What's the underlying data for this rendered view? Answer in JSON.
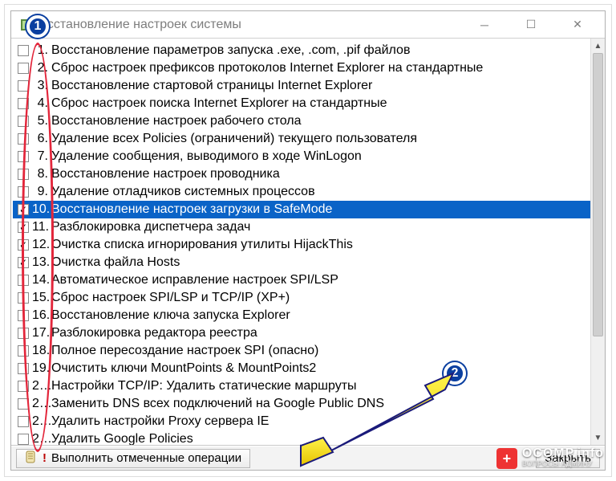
{
  "window": {
    "title": "осстановление настроек системы"
  },
  "items": [
    {
      "n": "1.",
      "checked": false,
      "selected": false,
      "label": "Восстановление параметров запуска .exe, .com, .pif файлов"
    },
    {
      "n": "2.",
      "checked": false,
      "selected": false,
      "label": "Сброс настроек префиксов протоколов Internet Explorer на стандартные"
    },
    {
      "n": "3.",
      "checked": false,
      "selected": false,
      "label": "Восстановление стартовой страницы Internet Explorer"
    },
    {
      "n": "4.",
      "checked": false,
      "selected": false,
      "label": "Сброс настроек поиска Internet Explorer на стандартные"
    },
    {
      "n": "5.",
      "checked": false,
      "selected": false,
      "label": "Восстановление настроек рабочего стола"
    },
    {
      "n": "6.",
      "checked": false,
      "selected": false,
      "label": "Удаление всех Policies (ограничений) текущего пользователя"
    },
    {
      "n": "7.",
      "checked": false,
      "selected": false,
      "label": "Удаление сообщения, выводимого в ходе WinLogon"
    },
    {
      "n": "8.",
      "checked": false,
      "selected": false,
      "label": "Восстановление настроек проводника"
    },
    {
      "n": "9.",
      "checked": false,
      "selected": false,
      "label": "Удаление отладчиков системных процессов"
    },
    {
      "n": "10.",
      "checked": true,
      "selected": true,
      "label": "Восстановление настроек загрузки в SafeMode"
    },
    {
      "n": "11.",
      "checked": true,
      "selected": false,
      "label": "Разблокировка диспетчера задач"
    },
    {
      "n": "12.",
      "checked": true,
      "selected": false,
      "label": "Очистка списка игнорирования утилиты HijackThis"
    },
    {
      "n": "13.",
      "checked": true,
      "selected": false,
      "label": "Очистка файла Hosts"
    },
    {
      "n": "14.",
      "checked": false,
      "selected": false,
      "label": "Автоматическое исправление настроек SPI/LSP"
    },
    {
      "n": "15.",
      "checked": false,
      "selected": false,
      "label": "Сброс настроек SPI/LSP и TCP/IP (XP+)"
    },
    {
      "n": "16.",
      "checked": false,
      "selected": false,
      "label": "Восстановление ключа запуска Explorer"
    },
    {
      "n": "17.",
      "checked": false,
      "selected": false,
      "label": "Разблокировка редактора реестра"
    },
    {
      "n": "18.",
      "checked": false,
      "selected": false,
      "label": "Полное пересоздание настроек SPI (опасно)"
    },
    {
      "n": "19.",
      "checked": false,
      "selected": false,
      "label": "Очистить ключи MountPoints & MountPoints2"
    },
    {
      "n": "2…",
      "checked": false,
      "selected": false,
      "label": "Настройки TCP/IP: Удалить статические маршруты"
    },
    {
      "n": "2…",
      "checked": false,
      "selected": false,
      "label": "Заменить DNS всех подключений на Google Public DNS"
    },
    {
      "n": "2…",
      "checked": false,
      "selected": false,
      "label": "Удалить настройки Proxy сервера IE"
    },
    {
      "n": "2…",
      "checked": false,
      "selected": false,
      "label": "Удалить Google Policies"
    }
  ],
  "buttons": {
    "execute": "Выполнить отмеченные операции",
    "close": "Закрыть"
  },
  "annotations": {
    "badge1": "1",
    "badge2": "2"
  },
  "watermark": {
    "line1": "OCOMP.info",
    "line2": "ВОПРОСЫ АДМИНУ"
  }
}
